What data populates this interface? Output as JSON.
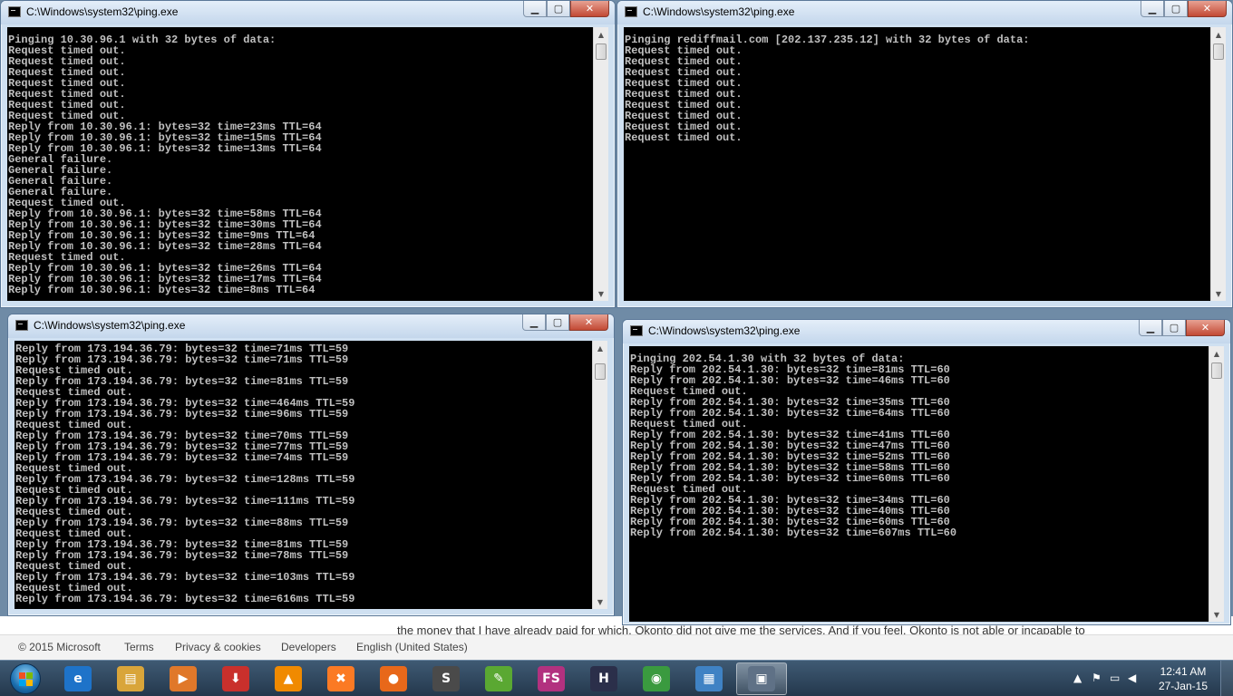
{
  "background_page": {
    "text_fragment": "the money that I have already paid for which, Okonto did not give me the services. And if you feel, Okonto is not able or incapable to",
    "footer": [
      "© 2015 Microsoft",
      "Terms",
      "Privacy & cookies",
      "Developers",
      "English (United States)"
    ]
  },
  "windows": [
    {
      "title": "C:\\Windows\\system32\\ping.exe",
      "lines": [
        "Pinging 10.30.96.1 with 32 bytes of data:",
        "Request timed out.",
        "Request timed out.",
        "Request timed out.",
        "Request timed out.",
        "Request timed out.",
        "Request timed out.",
        "Request timed out.",
        "Reply from 10.30.96.1: bytes=32 time=23ms TTL=64",
        "Reply from 10.30.96.1: bytes=32 time=15ms TTL=64",
        "Reply from 10.30.96.1: bytes=32 time=13ms TTL=64",
        "General failure.",
        "General failure.",
        "General failure.",
        "General failure.",
        "Request timed out.",
        "Reply from 10.30.96.1: bytes=32 time=58ms TTL=64",
        "Reply from 10.30.96.1: bytes=32 time=30ms TTL=64",
        "Reply from 10.30.96.1: bytes=32 time=9ms TTL=64",
        "Reply from 10.30.96.1: bytes=32 time=28ms TTL=64",
        "Request timed out.",
        "Reply from 10.30.96.1: bytes=32 time=26ms TTL=64",
        "Reply from 10.30.96.1: bytes=32 time=17ms TTL=64",
        "Reply from 10.30.96.1: bytes=32 time=8ms TTL=64"
      ]
    },
    {
      "title": "C:\\Windows\\system32\\ping.exe",
      "lines": [
        "Pinging rediffmail.com [202.137.235.12] with 32 bytes of data:",
        "Request timed out.",
        "Request timed out.",
        "Request timed out.",
        "Request timed out.",
        "Request timed out.",
        "Request timed out.",
        "Request timed out.",
        "Request timed out.",
        "Request timed out."
      ]
    },
    {
      "title": "C:\\Windows\\system32\\ping.exe",
      "lines": [
        "Reply from 173.194.36.79: bytes=32 time=71ms TTL=59",
        "Reply from 173.194.36.79: bytes=32 time=71ms TTL=59",
        "Request timed out.",
        "Reply from 173.194.36.79: bytes=32 time=81ms TTL=59",
        "Request timed out.",
        "Reply from 173.194.36.79: bytes=32 time=464ms TTL=59",
        "Reply from 173.194.36.79: bytes=32 time=96ms TTL=59",
        "Request timed out.",
        "Reply from 173.194.36.79: bytes=32 time=70ms TTL=59",
        "Reply from 173.194.36.79: bytes=32 time=77ms TTL=59",
        "Reply from 173.194.36.79: bytes=32 time=74ms TTL=59",
        "Request timed out.",
        "Reply from 173.194.36.79: bytes=32 time=128ms TTL=59",
        "Request timed out.",
        "Reply from 173.194.36.79: bytes=32 time=111ms TTL=59",
        "Request timed out.",
        "Reply from 173.194.36.79: bytes=32 time=88ms TTL=59",
        "Request timed out.",
        "Reply from 173.194.36.79: bytes=32 time=81ms TTL=59",
        "Reply from 173.194.36.79: bytes=32 time=78ms TTL=59",
        "Request timed out.",
        "Reply from 173.194.36.79: bytes=32 time=103ms TTL=59",
        "Request timed out.",
        "Reply from 173.194.36.79: bytes=32 time=616ms TTL=59"
      ]
    },
    {
      "title": "C:\\Windows\\system32\\ping.exe",
      "lines": [
        "Pinging 202.54.1.30 with 32 bytes of data:",
        "Reply from 202.54.1.30: bytes=32 time=81ms TTL=60",
        "Reply from 202.54.1.30: bytes=32 time=46ms TTL=60",
        "Request timed out.",
        "Reply from 202.54.1.30: bytes=32 time=35ms TTL=60",
        "Reply from 202.54.1.30: bytes=32 time=64ms TTL=60",
        "Request timed out.",
        "Reply from 202.54.1.30: bytes=32 time=41ms TTL=60",
        "Reply from 202.54.1.30: bytes=32 time=47ms TTL=60",
        "Reply from 202.54.1.30: bytes=32 time=52ms TTL=60",
        "Reply from 202.54.1.30: bytes=32 time=58ms TTL=60",
        "Reply from 202.54.1.30: bytes=32 time=60ms TTL=60",
        "Request timed out.",
        "Reply from 202.54.1.30: bytes=32 time=34ms TTL=60",
        "Reply from 202.54.1.30: bytes=32 time=40ms TTL=60",
        "Reply from 202.54.1.30: bytes=32 time=60ms TTL=60",
        "Reply from 202.54.1.30: bytes=32 time=607ms TTL=60"
      ]
    }
  ],
  "window_controls": {
    "minimize": "▁",
    "maximize": "▢",
    "close": "✕"
  },
  "taskbar": {
    "apps": [
      {
        "icon": "internet-explorer-icon",
        "glyph": "e",
        "color": "#1e73c9"
      },
      {
        "icon": "file-explorer-icon",
        "glyph": "▤",
        "color": "#d9a53a"
      },
      {
        "icon": "media-player-icon",
        "glyph": "▶",
        "color": "#e0782a"
      },
      {
        "icon": "download-manager-icon",
        "glyph": "⬇",
        "color": "#c9302c"
      },
      {
        "icon": "vlc-icon",
        "glyph": "▲",
        "color": "#f08a00"
      },
      {
        "icon": "xampp-icon",
        "glyph": "✖",
        "color": "#fb7a24"
      },
      {
        "icon": "firefox-icon",
        "glyph": "●",
        "color": "#e8681a"
      },
      {
        "icon": "sublime-text-icon",
        "glyph": "S",
        "color": "#4a4a4a"
      },
      {
        "icon": "feather-app-icon",
        "glyph": "✎",
        "color": "#5aa832"
      },
      {
        "icon": "fs-app-icon",
        "glyph": "FS",
        "color": "#b2317f"
      },
      {
        "icon": "h-app-icon",
        "glyph": "H",
        "color": "#2b2f4a"
      },
      {
        "icon": "chrome-icon",
        "glyph": "◉",
        "color": "#3a9a3f"
      },
      {
        "icon": "control-panel-icon",
        "glyph": "▦",
        "color": "#3f82c4"
      },
      {
        "icon": "console-window-icon",
        "glyph": "▣",
        "color": "#5f7186"
      }
    ],
    "active_index": 13,
    "tray": {
      "up_arrow": "▲",
      "flag": "⚑",
      "display": "▭",
      "volume": "◀"
    },
    "time": "12:41 AM",
    "date": "27-Jan-15"
  }
}
